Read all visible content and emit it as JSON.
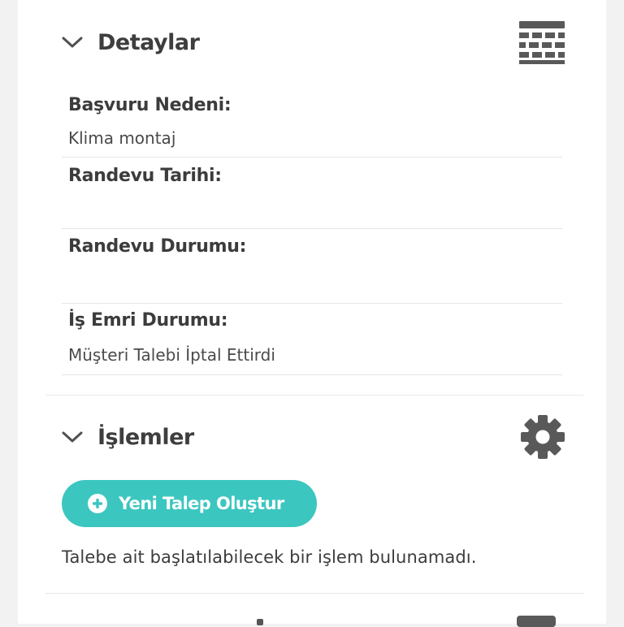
{
  "details": {
    "title": "Detaylar",
    "icon": "table-icon",
    "rows": [
      {
        "label": "Başvuru Nedeni:",
        "value": "Klima montaj"
      },
      {
        "label": "Randevu Tarihi:",
        "value": ""
      },
      {
        "label": "Randevu Durumu:",
        "value": ""
      },
      {
        "label": "İş Emri Durumu:",
        "value": "Müşteri Talebi İptal Ettirdi"
      }
    ]
  },
  "operations": {
    "title": "İşlemler",
    "icon": "gear-icon",
    "new_request_label": "Yeni Talep Oluştur",
    "empty_message": "Talebe ait başlatılabilecek bir işlem bulunamadı."
  },
  "colors": {
    "accent": "#3cc6c0",
    "icon_gray": "#595959",
    "text": "#3c3c3c"
  }
}
